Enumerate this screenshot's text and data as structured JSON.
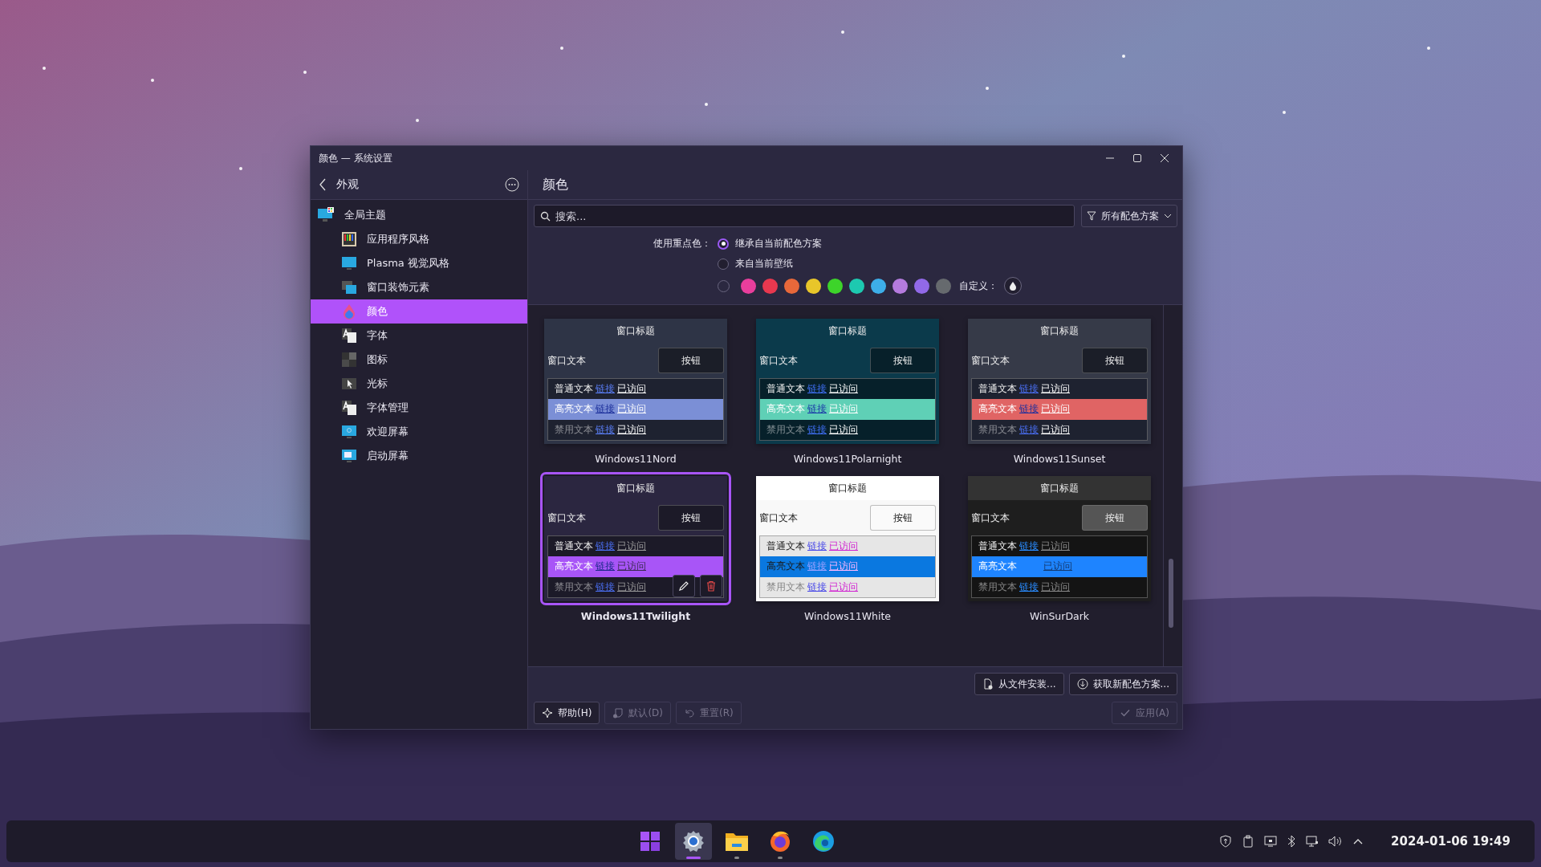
{
  "window": {
    "title": "颜色 — 系统设置"
  },
  "sidebar": {
    "back_label": "外观",
    "items": [
      {
        "label": "全局主题",
        "selected": false,
        "children": [
          {
            "label": "应用程序风格",
            "selected": false
          },
          {
            "label": "Plasma 视觉风格",
            "selected": false
          },
          {
            "label": "窗口装饰元素",
            "selected": false
          },
          {
            "label": "颜色",
            "selected": true
          },
          {
            "label": "字体",
            "selected": false
          },
          {
            "label": "图标",
            "selected": false
          },
          {
            "label": "光标",
            "selected": false
          },
          {
            "label": "字体管理",
            "selected": false
          },
          {
            "label": "欢迎屏幕",
            "selected": false
          },
          {
            "label": "启动屏幕",
            "selected": false
          }
        ]
      }
    ]
  },
  "page": {
    "title": "颜色",
    "search": {
      "placeholder": "搜索..."
    },
    "filter": "所有配色方案"
  },
  "accent": {
    "label": "使用重点色：",
    "options": [
      {
        "label": "继承自当前配色方案",
        "selected": true
      },
      {
        "label": "来自当前壁纸",
        "selected": false
      }
    ],
    "swatches": [
      {
        "kind": "none",
        "selected": false
      },
      {
        "kind": "color",
        "color": "#e83e9c",
        "selected": false
      },
      {
        "kind": "color",
        "color": "#e8384f",
        "selected": false
      },
      {
        "kind": "color",
        "color": "#e8683a",
        "selected": false
      },
      {
        "kind": "color",
        "color": "#e8c62a",
        "selected": false
      },
      {
        "kind": "color",
        "color": "#3dd42a",
        "selected": false
      },
      {
        "kind": "color",
        "color": "#1dc9b0",
        "selected": false
      },
      {
        "kind": "color",
        "color": "#3daee9",
        "selected": false
      },
      {
        "kind": "color",
        "color": "#b57bde",
        "selected": false
      },
      {
        "kind": "color",
        "color": "#9169e8",
        "selected": false
      },
      {
        "kind": "color",
        "color": "#666a6e",
        "selected": false
      }
    ],
    "custom_label": "自定义："
  },
  "schemes": [
    {
      "name": "Windows11Nord",
      "selected": false,
      "color": "#7b8fd6",
      "title": "窗口标题",
      "window_text": "窗口文本",
      "button": "按钮",
      "rows": [
        {
          "kind": "normal",
          "text": "普通文本",
          "link": "链接",
          "visited": "已访问"
        },
        {
          "kind": "highlight",
          "text": "高亮文本",
          "link": "链接",
          "visited": "已访问"
        },
        {
          "kind": "disabled",
          "text": "禁用文本",
          "link": "链接",
          "visited": "已访问"
        }
      ]
    },
    {
      "name": "Windows11Polarnight",
      "selected": false,
      "color": "#5fd0b6",
      "title": "窗口标题",
      "window_text": "窗口文本",
      "button": "按钮",
      "rows": [
        {
          "kind": "normal",
          "text": "普通文本",
          "link": "链接",
          "visited": "已访问"
        },
        {
          "kind": "highlight",
          "text": "高亮文本",
          "link": "链接",
          "visited": "已访问"
        },
        {
          "kind": "disabled",
          "text": "禁用文本",
          "link": "链接",
          "visited": "已访问"
        }
      ]
    },
    {
      "name": "Windows11Sunset",
      "selected": false,
      "color": "#e06464",
      "title": "窗口标题",
      "window_text": "窗口文本",
      "button": "按钮",
      "rows": [
        {
          "kind": "normal",
          "text": "普通文本",
          "link": "链接",
          "visited": "已访问"
        },
        {
          "kind": "highlight",
          "text": "高亮文本",
          "link": "链接",
          "visited": "已访问"
        },
        {
          "kind": "disabled",
          "text": "禁用文本",
          "link": "链接",
          "visited": "已访问"
        }
      ]
    },
    {
      "name": "Windows11Twilight",
      "selected": true,
      "color": "#a855f7",
      "title": "窗口标题",
      "window_text": "窗口文本",
      "button": "按钮",
      "rows": [
        {
          "kind": "normal",
          "text": "普通文本",
          "link": "链接",
          "visited": "已访问"
        },
        {
          "kind": "highlight",
          "text": "高亮文本",
          "link": "链接",
          "visited": "已访问"
        },
        {
          "kind": "disabled",
          "text": "禁用文本",
          "link": "链接",
          "visited": "已访问"
        }
      ]
    },
    {
      "name": "Windows11White",
      "selected": false,
      "color": "#0a78e0",
      "title": "窗口标题",
      "window_text": "窗口文本",
      "button": "按钮",
      "rows": [
        {
          "kind": "normal",
          "text": "普通文本",
          "link": "链接",
          "visited": "已访问"
        },
        {
          "kind": "highlight",
          "text": "高亮文本",
          "link": "链接",
          "visited": "已访问"
        },
        {
          "kind": "disabled",
          "text": "禁用文本",
          "link": "链接",
          "visited": "已访问"
        }
      ]
    },
    {
      "name": "WinSurDark",
      "selected": false,
      "color": "#1e84ff",
      "title": "窗口标题",
      "window_text": "窗口文本",
      "button": "按钮",
      "rows": [
        {
          "kind": "normal",
          "text": "普通文本",
          "link": "链接",
          "visited": "已访问"
        },
        {
          "kind": "highlight",
          "text": "高亮文本",
          "visited": "已访问"
        },
        {
          "kind": "disabled",
          "text": "禁用文本",
          "link": "链接",
          "visited": "已访问"
        }
      ]
    }
  ],
  "actions": [
    {
      "kind": "install",
      "label": "从文件安装..."
    },
    {
      "kind": "download",
      "label": "获取新配色方案..."
    }
  ],
  "footer": [
    {
      "kind": "help",
      "label": "帮助(H)",
      "disabled": false
    },
    {
      "kind": "defaults",
      "label": "默认(D)",
      "disabled": true
    },
    {
      "kind": "reset",
      "label": "重置(R)",
      "disabled": true
    },
    {
      "kind": "apply",
      "label": "应用(A)",
      "disabled": true
    }
  ],
  "taskbar": {
    "apps": [
      {
        "kind": "start",
        "active": false,
        "running": false
      },
      {
        "kind": "settings",
        "active": true,
        "running": true
      },
      {
        "kind": "files",
        "active": false,
        "running": true
      },
      {
        "kind": "firefox",
        "active": false,
        "running": true
      },
      {
        "kind": "edge",
        "active": false,
        "running": false
      }
    ],
    "clock": "2024-01-06 19:49"
  }
}
